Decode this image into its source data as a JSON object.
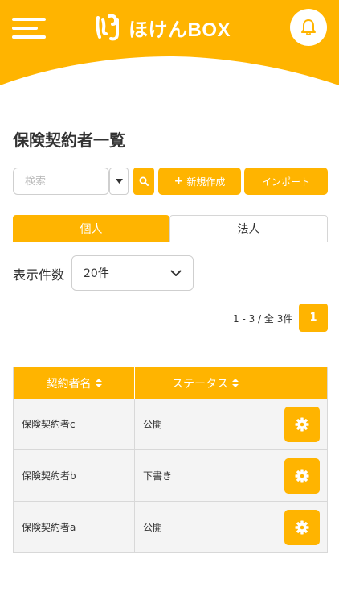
{
  "header": {
    "logo_text": "ほけんBOX",
    "brand_color": "#ffb400",
    "icons": {
      "menu": "hamburger-menu-icon",
      "logo": "hokenbox-logo-icon",
      "notifications": "bell-icon"
    }
  },
  "page": {
    "title": "保険契約者一覧"
  },
  "search": {
    "placeholder": "検索",
    "value": ""
  },
  "toolbar": {
    "new_label": "新規作成",
    "import_label": "インポート"
  },
  "tabs": [
    {
      "label": "個人",
      "active": true
    },
    {
      "label": "法人",
      "active": false
    }
  ],
  "per_page": {
    "label": "表示件数",
    "selected": "20件"
  },
  "pagination": {
    "info": "1 - 3 / 全 3件",
    "current_page": "1"
  },
  "table": {
    "columns": [
      "契約者名",
      "ステータス",
      ""
    ],
    "rows": [
      {
        "name": "保険契約者c",
        "status": "公開"
      },
      {
        "name": "保険契約者b",
        "status": "下書き"
      },
      {
        "name": "保険契約者a",
        "status": "公開"
      }
    ]
  }
}
